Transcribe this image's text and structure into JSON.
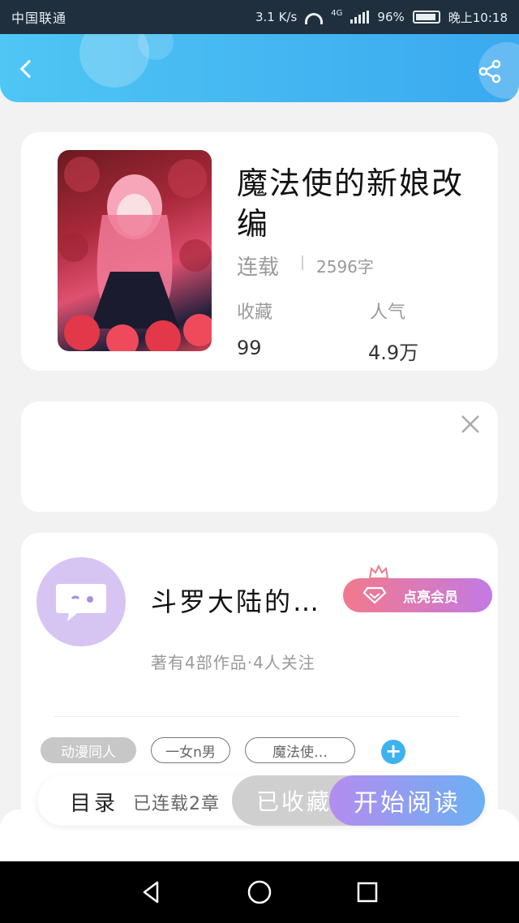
{
  "status_bar": {
    "carrier": "中国联通",
    "net_speed": "3.1 K/s",
    "network_type": "4G",
    "battery": "96%",
    "time": "晚上10:18"
  },
  "book": {
    "title": "魔法使的新娘改编",
    "status": "连载",
    "word_count": "2596字",
    "favorites_label": "收藏",
    "favorites_value": "99",
    "popularity_label": "人气",
    "popularity_value": "4.9万"
  },
  "author": {
    "name": "斗罗大陆的…",
    "vip_label": "点亮会员",
    "meta": "著有4部作品·4人关注",
    "tags": [
      "动漫同人",
      "一女n男",
      "魔法使…"
    ]
  },
  "bottom_bar": {
    "toc_label": "目录",
    "chapters_label": "已连载2章",
    "collected_label": "已收藏",
    "read_label": "开始阅读"
  },
  "icons": {
    "back": "chevron-left-icon",
    "share": "share-icon",
    "close": "close-icon",
    "crown": "crown-icon",
    "diamond": "diamond-icon",
    "add": "plus-icon"
  },
  "colors": {
    "header_start": "#4fc6f4",
    "header_end": "#3aa9ef",
    "vip_start": "#f2798c",
    "vip_end": "#c27ae4",
    "read_start": "#b58cf0",
    "read_end": "#6ab0f2",
    "accent_blue": "#3db2f0"
  }
}
